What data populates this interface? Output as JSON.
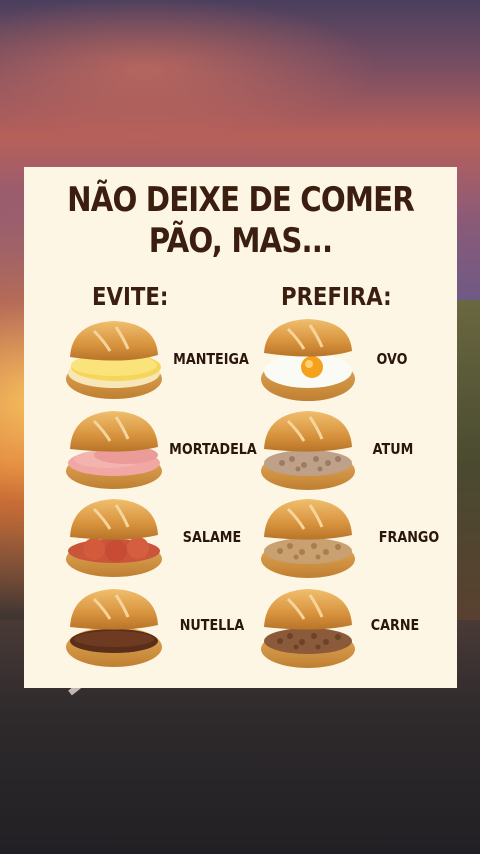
{
  "poster": {
    "title_line1": "NÃO DEIXE DE COMER",
    "title_line2": "PÃO, MAS...",
    "avoid_heading": "EVITE:",
    "prefer_heading": "PREFIRA:"
  },
  "avoid_items": [
    {
      "label": "MANTEIGA",
      "icon": "bread-butter-icon"
    },
    {
      "label": "MORTADELA",
      "icon": "bread-mortadella-icon"
    },
    {
      "label": "SALAME",
      "icon": "bread-salami-icon"
    },
    {
      "label": "NUTELLA",
      "icon": "bread-nutella-icon"
    }
  ],
  "prefer_items": [
    {
      "label": "OVO",
      "icon": "bread-egg-icon"
    },
    {
      "label": "ATUM",
      "icon": "bread-tuna-icon"
    },
    {
      "label": "FRANGO",
      "icon": "bread-chicken-icon"
    },
    {
      "label": "CARNE",
      "icon": "bread-beef-icon"
    }
  ],
  "colors": {
    "card_background": "#fdf6e4",
    "text_dark_brown": "#3b1e10",
    "bread_crust": "#d99a45"
  }
}
